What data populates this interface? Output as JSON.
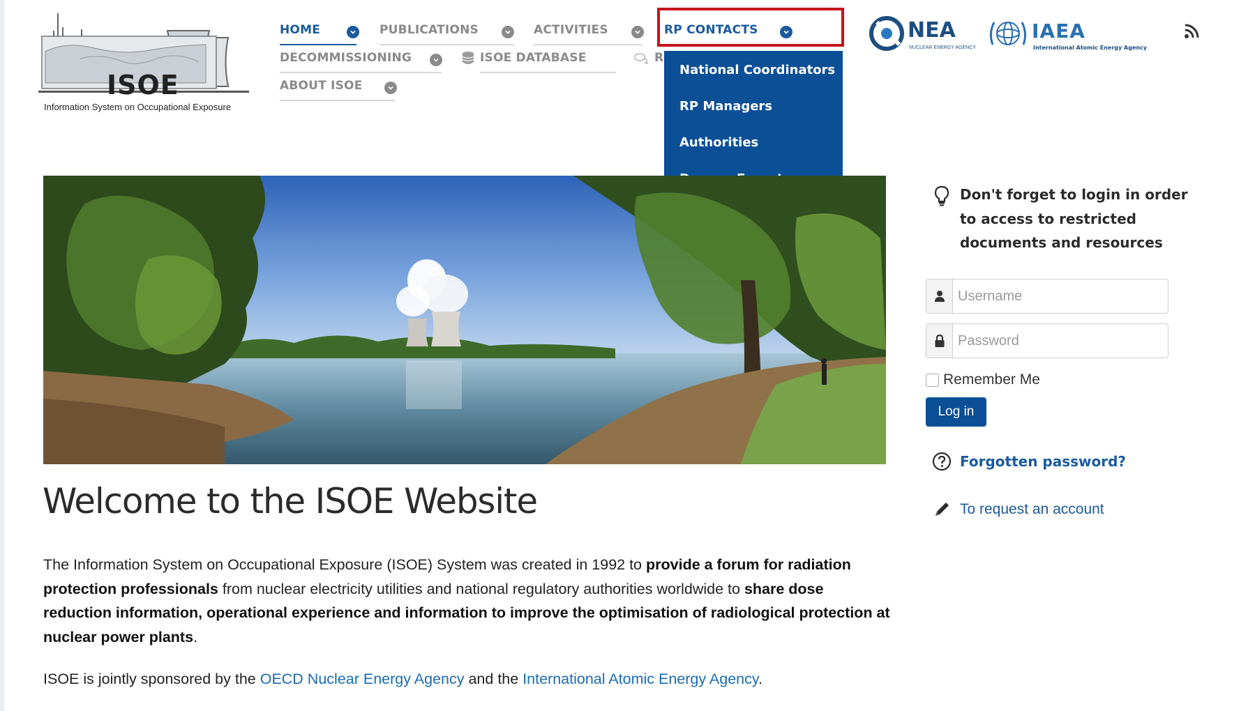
{
  "logo": {
    "text": "ISOE",
    "caption": "Information System on Occupational Exposure"
  },
  "nav": {
    "home": "HOME",
    "publications": "PUBLICATIONS",
    "activities": "ACTIVITIES",
    "rp_contacts": "RP CONTACTS",
    "decommissioning": "DECOMMISSIONING",
    "isoe_database": "ISOE DATABASE",
    "partial_item": "R",
    "about_isoe": "ABOUT ISOE"
  },
  "dropdown": {
    "items": [
      "National Coordinators",
      "RP Managers",
      "Authorities",
      "Decom. Experts"
    ]
  },
  "partners": {
    "nea": {
      "name": "NEA",
      "subtitle": "NUCLEAR ENERGY AGENCY"
    },
    "iaea": {
      "name": "IAEA",
      "subtitle": "International Atomic Energy Agency"
    }
  },
  "main": {
    "title": "Welcome to the ISOE Website",
    "intro_1": "The Information System on Occupational Exposure (ISOE) System was created in 1992 to ",
    "intro_bold_1": "provide a forum for radiation protection professionals",
    "intro_2": " from nuclear electricity utilities and national regulatory authorities worldwide to ",
    "intro_bold_2": "share dose reduction information, operational experience and information to improve the optimisation of radiological protection at nuclear power plants",
    "intro_3": ".",
    "sponsors_1": "ISOE is jointly sponsored by the ",
    "sponsors_link_1": "OECD Nuclear Energy Agency",
    "sponsors_2": " and the ",
    "sponsors_link_2": "International Atomic Energy Agency",
    "sponsors_3": "."
  },
  "login": {
    "reminder": "Don't forget to login in order to access to restricted documents and resources",
    "username_placeholder": "Username",
    "password_placeholder": "Password",
    "remember_me": "Remember Me",
    "login_button": "Log in",
    "forgot_password": "Forgotten password?",
    "request_account": "To request an account"
  },
  "icons": {
    "nav_chevron": "chevron-down-icon",
    "database": "database-icon",
    "chat": "chat-icon",
    "rss": "rss-icon",
    "lightbulb": "lightbulb-icon",
    "user": "user-icon",
    "lock": "lock-icon",
    "question": "question-icon",
    "pencil": "pencil-icon"
  },
  "colors": {
    "brand_blue": "#0b4f97",
    "link_blue": "#1a6bb3",
    "highlight_red": "#c4141c",
    "nav_grey": "#8a8a8a"
  }
}
